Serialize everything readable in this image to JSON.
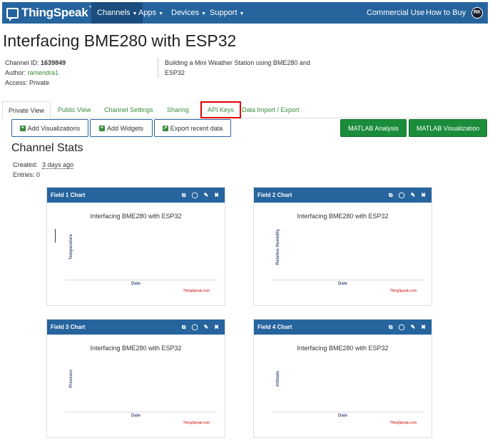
{
  "navbar": {
    "brand": "ThingSpeak",
    "brand_tm": "™",
    "items": [
      {
        "label": "Channels"
      },
      {
        "label": "Apps"
      },
      {
        "label": "Devices"
      },
      {
        "label": "Support"
      }
    ],
    "commercial_use": "Commercial Use",
    "how_to_buy": "How to Buy",
    "avatar_initials": "RK"
  },
  "channel": {
    "title": "Interfacing BME280 with ESP32",
    "id_label": "Channel ID:",
    "id_value": "1639849",
    "author_label": "Author:",
    "author_value": "ramendra1",
    "access_label": "Access:",
    "access_value": "Private",
    "description": "Building a Mini Weather Station using BME280 and ESP32"
  },
  "tabs": [
    {
      "label": "Private View",
      "active": true
    },
    {
      "label": "Public View"
    },
    {
      "label": "Channel Settings"
    },
    {
      "label": "Sharing"
    },
    {
      "label": "API Keys",
      "highlighted": true
    },
    {
      "label": "Data Import / Export"
    }
  ],
  "actions": {
    "add_visualizations": "Add Visualizations",
    "add_widgets": "Add Widgets",
    "export_recent_data": "Export recent data",
    "matlab_analysis": "MATLAB Analysis",
    "matlab_visualization": "MATLAB Visualization"
  },
  "stats": {
    "title": "Channel Stats",
    "created_label": "Created:",
    "created_value": "3 days ago",
    "entries_label": "Entries:",
    "entries_value": "0"
  },
  "charts": [
    {
      "header": "Field 1 Chart",
      "title": "Interfacing BME280 with ESP32",
      "ylabel": "Temperature",
      "xlabel": "Date",
      "credit": "ThingSpeak.com"
    },
    {
      "header": "Field 2 Chart",
      "title": "Interfacing BME280 with ESP32",
      "ylabel": "Relative Humidity",
      "xlabel": "Date",
      "credit": "ThingSpeak.com"
    },
    {
      "header": "Field 3 Chart",
      "title": "Interfacing BME280 with ESP32",
      "ylabel": "Pressure",
      "xlabel": "Date",
      "credit": "ThingSpeak.com"
    },
    {
      "header": "Field 4 Chart",
      "title": "Interfacing BME280 with ESP32",
      "ylabel": "Altitude",
      "xlabel": "Date",
      "credit": "ThingSpeak.com"
    }
  ],
  "colors": {
    "navbar": "#26649e",
    "link_green": "#3a8c3a",
    "button_green": "#1a8c3a",
    "highlight_red": "#e00000"
  },
  "icons": {
    "panel_icons": [
      "external-link-icon",
      "comment-icon",
      "pencil-icon",
      "close-icon"
    ]
  }
}
